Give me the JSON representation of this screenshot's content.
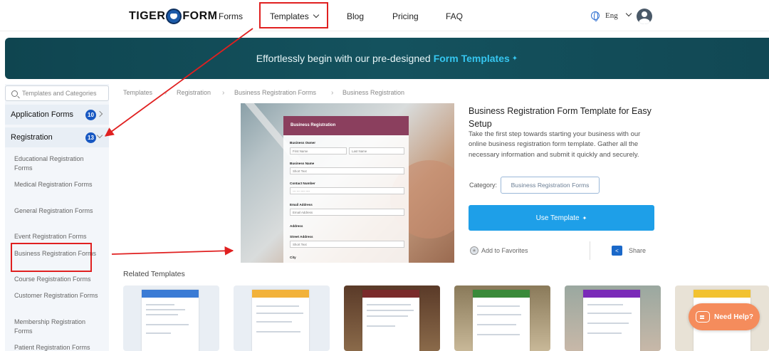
{
  "nav": {
    "logo_left": "TIGER",
    "logo_right": "FORM",
    "links": [
      "Forms",
      "Templates",
      "Blog",
      "Pricing",
      "FAQ"
    ],
    "lang": "Eng"
  },
  "banner": {
    "text": "Effortlessly begin with our pre-designed",
    "highlight": "Form Templates",
    "icon": "sparkle-icon"
  },
  "sidebar": {
    "search_placeholder": "Templates and Categories",
    "categories": [
      {
        "label": "Application Forms",
        "count": "10"
      },
      {
        "label": "Registration",
        "count": "13"
      }
    ],
    "subitems": [
      "Educational Registration Forms",
      "Medical Registration Forms",
      "General Registration Forms",
      "Event Registration Forms",
      "Business Registration Forms",
      "Course Registration Forms",
      "Customer Registration Forms",
      "Membership Registration Forms",
      "Patient Registration Forms"
    ]
  },
  "breadcrumb": [
    "Templates",
    "Registration",
    "Business Registration Forms",
    "Business Registration"
  ],
  "preview": {
    "form_title": "Business Registration",
    "fields": {
      "owner": "Business Owner",
      "first": "First Name",
      "last": "Last Name",
      "name": "Business Name",
      "short1": "Short Text",
      "contact": "Contact Number",
      "phone": "--- --- ---- ----",
      "email": "Email Address",
      "email_ph": "Email Address",
      "address": "Address",
      "street": "Street Address",
      "short2": "Short Text",
      "city": "City"
    }
  },
  "detail": {
    "title": "Business Registration Form Template for Easy Setup",
    "description": "Take the first step towards starting your business with our online business registration form template. Gather all the necessary information and submit it quickly and securely.",
    "category_label": "Category:",
    "category_value": "Business Registration Forms",
    "use_button": "Use Template",
    "favorite": "Add to Favorites",
    "share": "Share"
  },
  "related": {
    "title": "Related Templates",
    "help": "Need Help?"
  },
  "colors": {
    "accent": "#1e9fe8",
    "banner": "#14525e",
    "annotation": "#e02020",
    "help": "#f58c5c",
    "related_headers": [
      "#3a7bd5",
      "#f2b23a",
      "#7a2b2b",
      "#3a8a3a",
      "#7a2ab8",
      "#f2c230"
    ]
  }
}
